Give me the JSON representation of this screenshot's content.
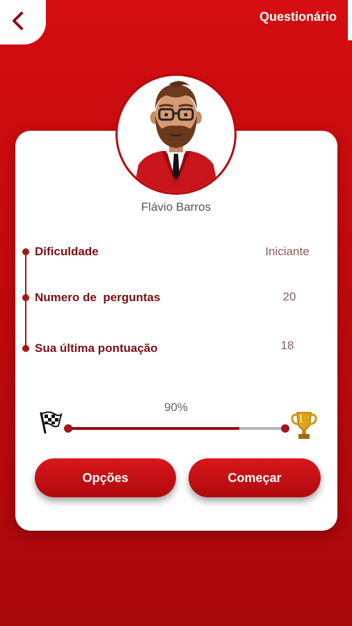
{
  "header": {
    "title": "Questionário",
    "back_icon": "chevron-left-icon"
  },
  "profile": {
    "name": "Flávio Barros",
    "avatar_icon": "avatar-illustration"
  },
  "info_rows": [
    {
      "label": "Dificuldade",
      "value": "Iniciante"
    },
    {
      "label": "Numero de  perguntas",
      "value": "20"
    },
    {
      "label": "Sua última pontuação",
      "value": "18"
    }
  ],
  "progress": {
    "percent_label": "90%",
    "value": 0.79,
    "start_icon": "checkered-flag-icon",
    "end_icon": "trophy-icon"
  },
  "buttons": {
    "options_label": "Opções",
    "start_label": "Começar"
  },
  "colors": {
    "primary": "#c00a0d",
    "dark_red": "#7a0f12",
    "white": "#ffffff"
  }
}
